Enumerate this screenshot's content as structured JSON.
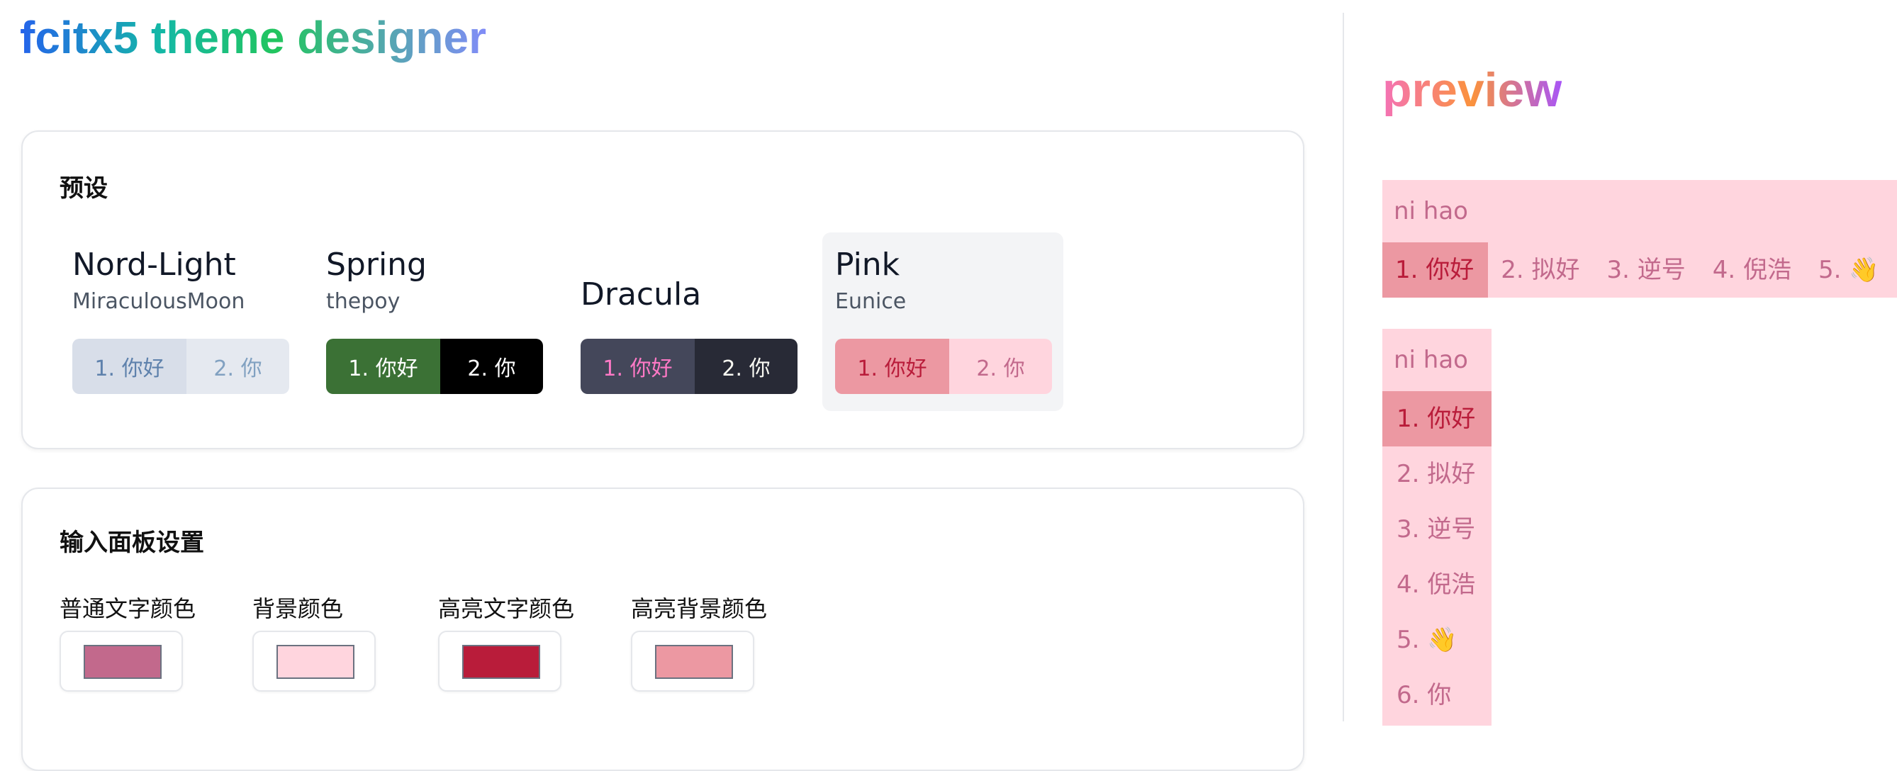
{
  "app": {
    "title": "fcitx5 theme designer"
  },
  "presets": {
    "heading": "预设",
    "items": [
      {
        "name": "Nord-Light",
        "author": "MiraculousMoon",
        "cand1": "1. 你好",
        "cand2": "2. 你",
        "colors": {
          "hl_bg": "#d8dee9",
          "hl_text": "#5e81ac",
          "bg": "#e5e9f0",
          "text": "#81a1c1"
        }
      },
      {
        "name": "Spring",
        "author": "thepoy",
        "cand1": "1. 你好",
        "cand2": "2. 你",
        "colors": {
          "hl_bg": "#3b7135",
          "hl_text": "#ffffff",
          "bg": "#000000",
          "text": "#ffffff"
        }
      },
      {
        "name": "Dracula",
        "author": "",
        "cand1": "1. 你好",
        "cand2": "2. 你",
        "colors": {
          "hl_bg": "#44475a",
          "hl_text": "#ff79c6",
          "bg": "#282a36",
          "text": "#f8f8f2"
        }
      },
      {
        "name": "Pink",
        "author": "Eunice",
        "cand1": "1. 你好",
        "cand2": "2. 你",
        "selected": true,
        "colors": {
          "hl_bg": "#ec98a2",
          "hl_text": "#b91c3a",
          "bg": "#ffd5de",
          "text": "#c2698c"
        }
      }
    ]
  },
  "panel_settings": {
    "heading": "输入面板设置",
    "fields": [
      {
        "label": "普通文字颜色",
        "color": "#c2698c"
      },
      {
        "label": "背景颜色",
        "color": "#ffd5de"
      },
      {
        "label": "高亮文字颜色",
        "color": "#b91c3a"
      },
      {
        "label": "高亮背景颜色",
        "color": "#ec98a2"
      }
    ]
  },
  "preview": {
    "title": "preview",
    "preedit": "ni hao",
    "horizontal_candidates": [
      "1. 你好",
      "2. 拟好",
      "3. 逆号",
      "4. 倪浩",
      "5. 👋"
    ],
    "vertical_candidates": [
      "1. 你好",
      "2. 拟好",
      "3. 逆号",
      "4. 倪浩",
      "5. 👋",
      "6. 你"
    ],
    "highlighted_index": 0
  }
}
